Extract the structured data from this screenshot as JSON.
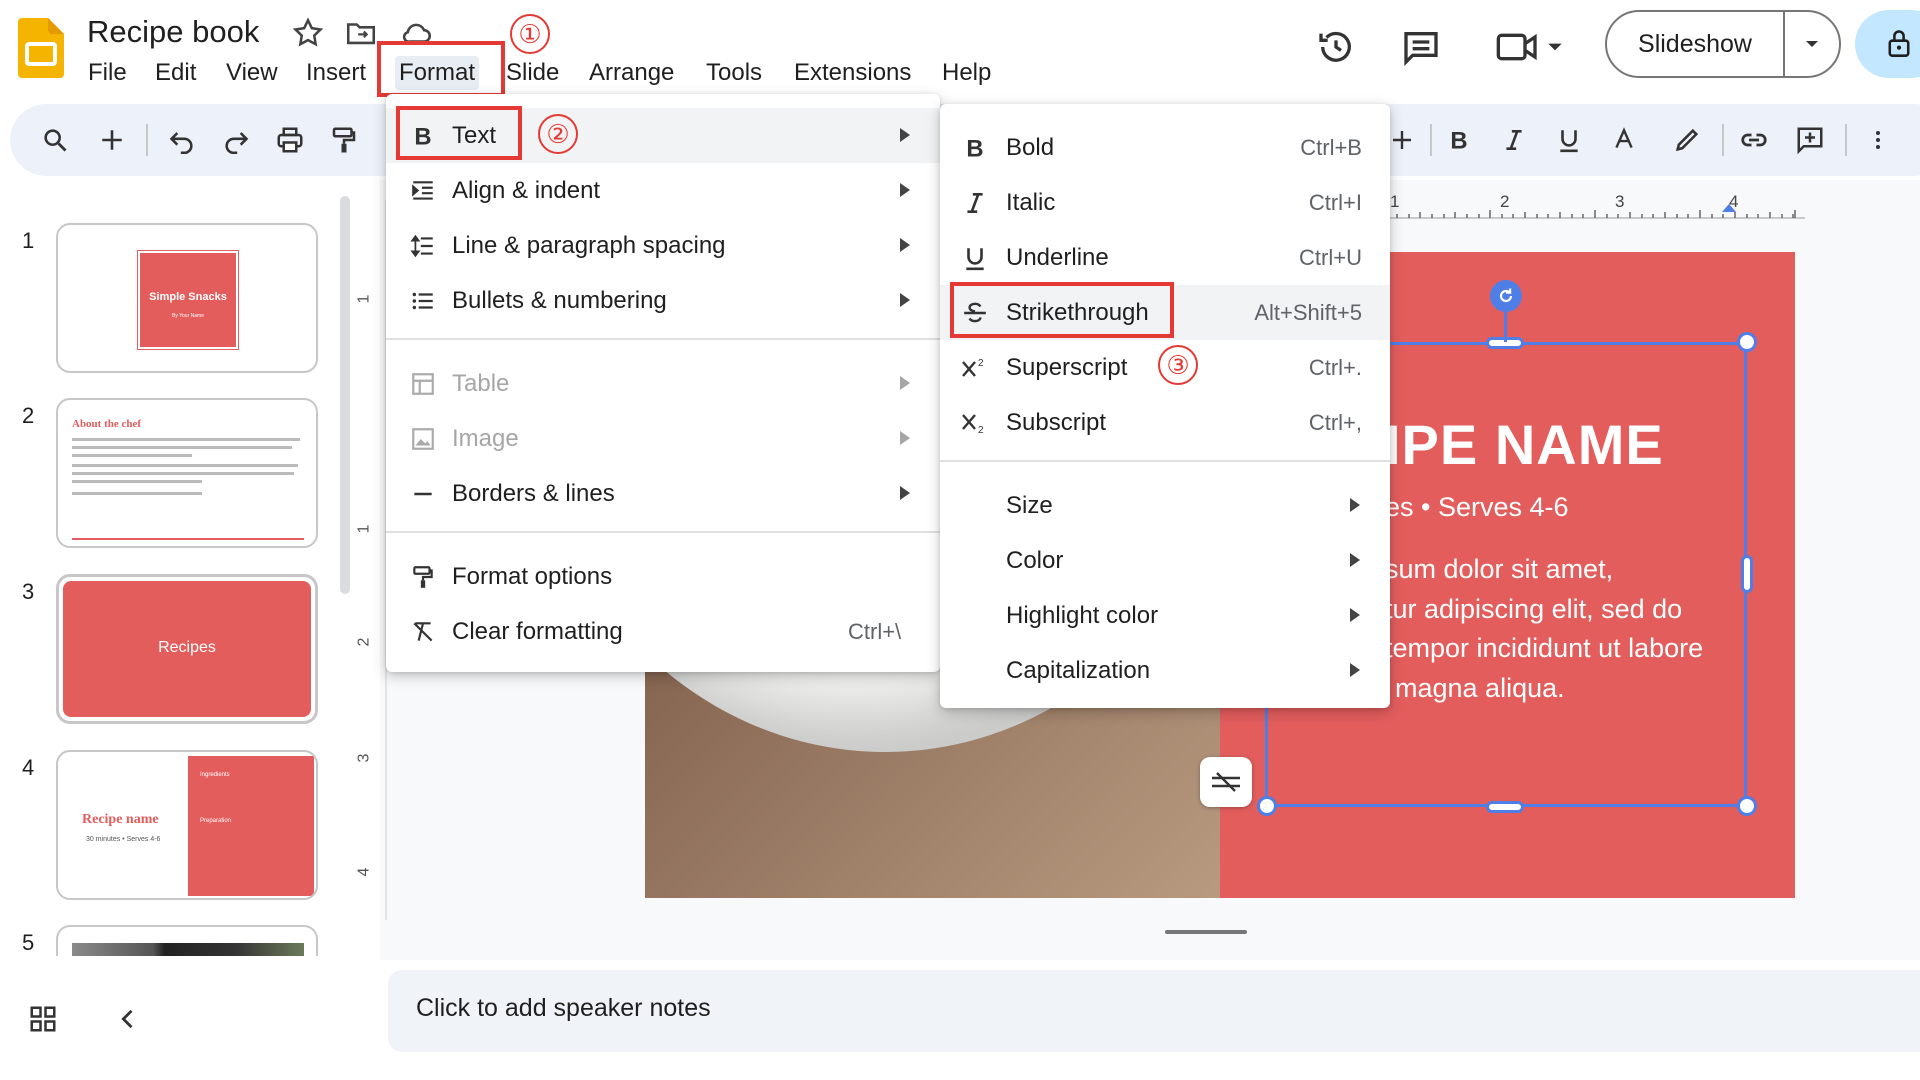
{
  "header": {
    "title": "Recipe book",
    "menus": [
      "File",
      "Edit",
      "View",
      "Insert",
      "Format",
      "Slide",
      "Arrange",
      "Tools",
      "Extensions",
      "Help"
    ],
    "slideshow_label": "Slideshow"
  },
  "filmstrip": {
    "numbers": [
      "1",
      "2",
      "3",
      "4",
      "5"
    ],
    "slide1_title": "Simple Snacks",
    "slide1_sub": "By Your Name",
    "slide2_title": "About the chef",
    "slide3_title": "Recipes",
    "slide4_title": "Recipe name",
    "slide4_sub": "30 minutes • Serves 4-6",
    "slide4_ingredients": "Ingredients",
    "slide4_preparation": "Preparation"
  },
  "slide": {
    "title": "IPE NAME",
    "subtitle": "es • Serves 4-6",
    "body": [
      "sum dolor sit amet,",
      "tur adipiscing elit, sed do",
      "tempor incididunt ut labore",
      "magna aliqua."
    ]
  },
  "rulers": {
    "left": [
      "1",
      "1",
      "2",
      "3",
      "4"
    ],
    "top": [
      "1",
      "2",
      "3",
      "4"
    ]
  },
  "format_menu": {
    "items": [
      {
        "label": "Text"
      },
      {
        "label": "Align & indent"
      },
      {
        "label": "Line & paragraph spacing"
      },
      {
        "label": "Bullets & numbering"
      },
      {
        "label": "Table"
      },
      {
        "label": "Image"
      },
      {
        "label": "Borders & lines"
      },
      {
        "label": "Format options"
      },
      {
        "label": "Clear formatting",
        "shortcut": "Ctrl+\\"
      }
    ]
  },
  "text_submenu": {
    "items": [
      {
        "label": "Bold",
        "shortcut": "Ctrl+B"
      },
      {
        "label": "Italic",
        "shortcut": "Ctrl+I"
      },
      {
        "label": "Underline",
        "shortcut": "Ctrl+U"
      },
      {
        "label": "Strikethrough",
        "shortcut": "Alt+Shift+5"
      },
      {
        "label": "Superscript",
        "shortcut": "Ctrl+."
      },
      {
        "label": "Subscript",
        "shortcut": "Ctrl+,"
      },
      {
        "label": "Size"
      },
      {
        "label": "Color"
      },
      {
        "label": "Highlight color"
      },
      {
        "label": "Capitalization"
      }
    ]
  },
  "annotations": {
    "step1": "①",
    "step2": "②",
    "step3": "③"
  },
  "notes": {
    "placeholder": "Click to add speaker notes"
  },
  "colors": {
    "accent_red": "#e53935",
    "slide_red": "#e35d5d",
    "selection_blue": "#4f7fe6"
  }
}
